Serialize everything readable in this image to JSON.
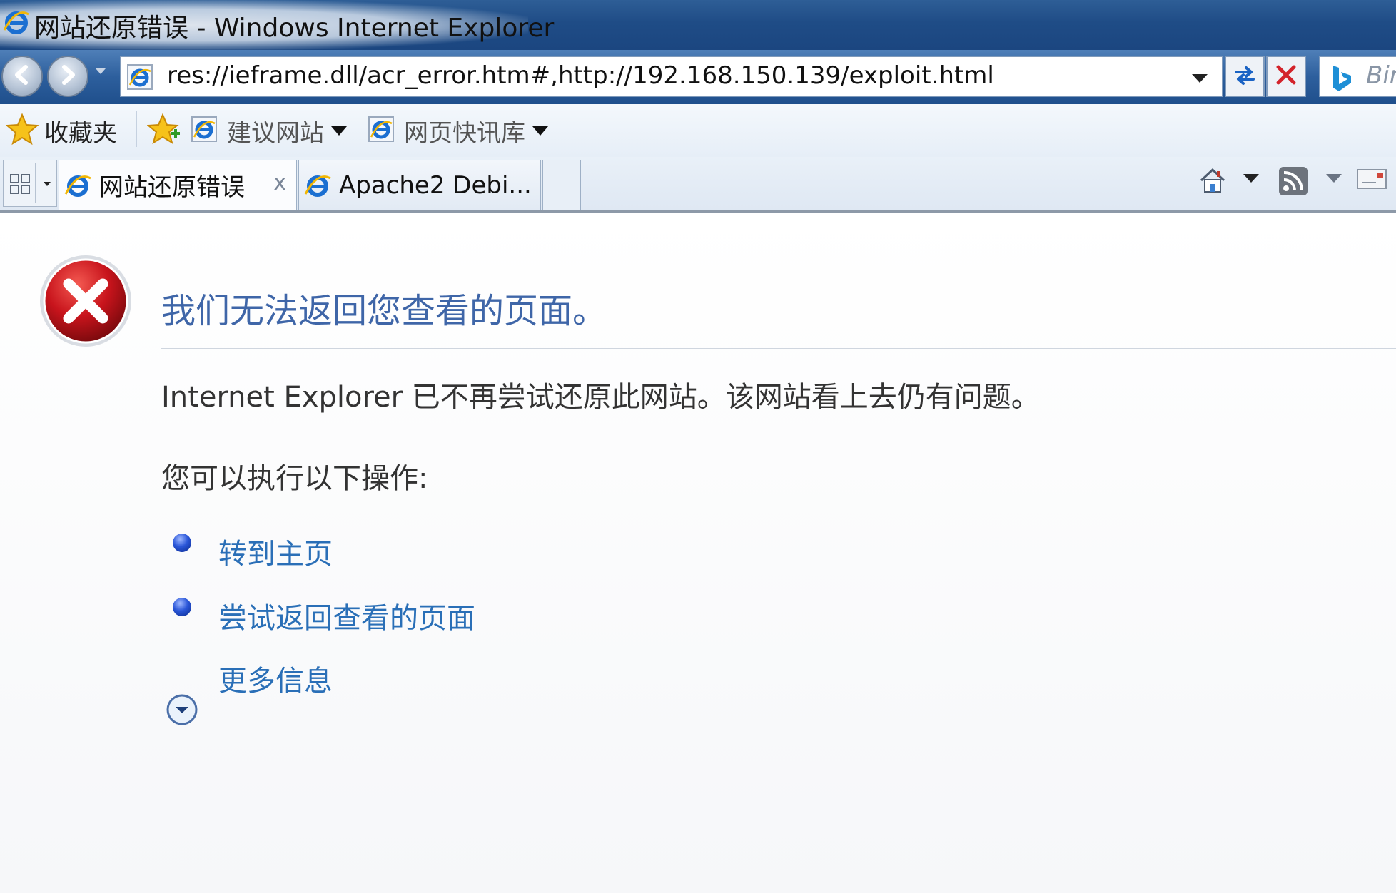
{
  "window": {
    "title": "网站还原错误 - Windows Internet Explorer"
  },
  "navigation": {
    "back_icon": "back-arrow-icon",
    "forward_icon": "forward-arrow-icon",
    "address_url": "res://ieframe.dll/acr_error.htm#,http://192.168.150.139/exploit.html",
    "search_placeholder": "Bin"
  },
  "favorites_bar": {
    "favorites_label": "收藏夹",
    "suggested_sites_label": "建议网站",
    "web_slice_label": "网页快讯库"
  },
  "tabs": [
    {
      "label": "网站还原错误",
      "close": "x",
      "active": true
    },
    {
      "label": "Apache2 Debi...",
      "active": false
    }
  ],
  "error_page": {
    "heading": "我们无法返回您查看的页面。",
    "message": "Internet Explorer 已不再尝试还原此网站。该网站看上去仍有问题。",
    "actions_heading": "您可以执行以下操作:",
    "actions": [
      {
        "label": "转到主页"
      },
      {
        "label": "尝试返回查看的页面"
      }
    ],
    "more_info_label": "更多信息"
  },
  "colors": {
    "title_bar": "#1f4c86",
    "heading": "#3f66a8",
    "link": "#2a6fb7",
    "error_red": "#c8141c"
  }
}
